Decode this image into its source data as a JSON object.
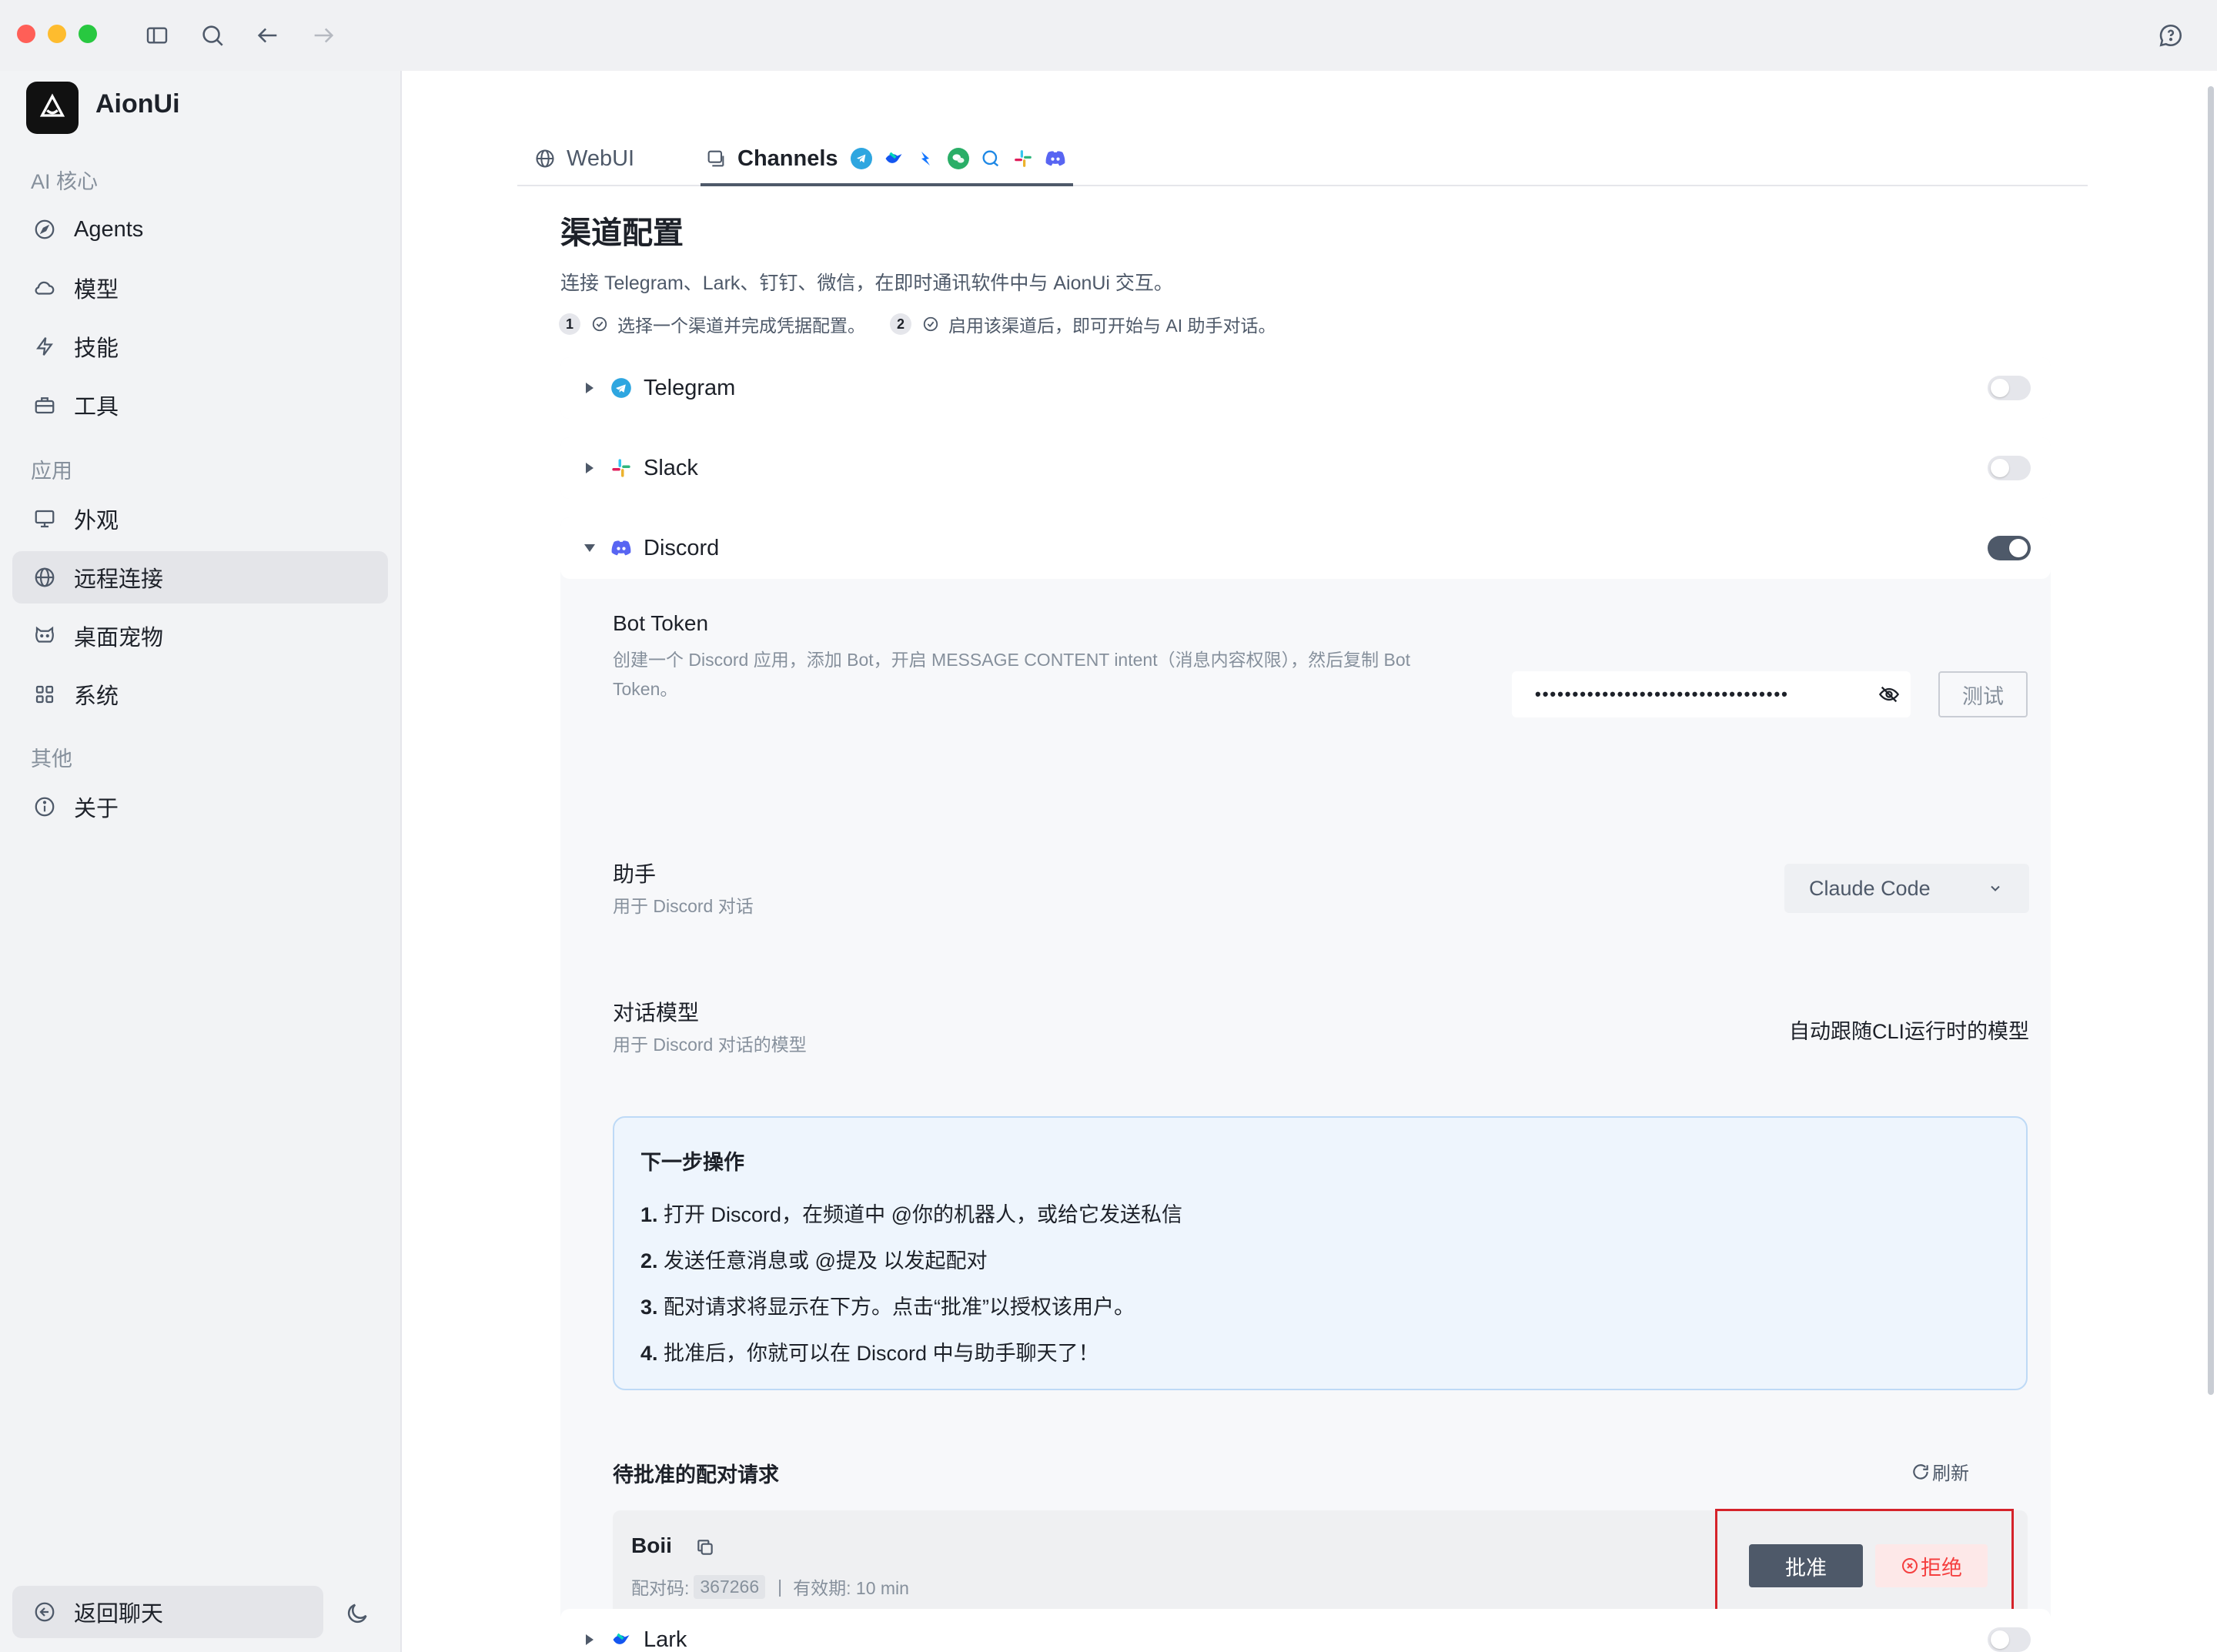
{
  "colors": {
    "accent": "#4e5969",
    "danger": "#f53f3f",
    "highlight": "#d5232a",
    "info_bg": "#eef5fd"
  },
  "titlebar": {
    "icons": [
      "sidebar-toggle-icon",
      "search-icon",
      "arrow-left-icon",
      "arrow-right-icon",
      "feedback-icon"
    ]
  },
  "sidebar": {
    "app_name": "AionUi",
    "sections": [
      {
        "title": "AI 核心",
        "items": [
          {
            "label": "Agents",
            "icon": "compass-icon"
          },
          {
            "label": "模型",
            "icon": "cloud-icon"
          },
          {
            "label": "技能",
            "icon": "lightning-icon"
          },
          {
            "label": "工具",
            "icon": "toolbox-icon"
          }
        ]
      },
      {
        "title": "应用",
        "items": [
          {
            "label": "外观",
            "icon": "monitor-icon"
          },
          {
            "label": "远程连接",
            "icon": "globe-icon",
            "active": true
          },
          {
            "label": "桌面宠物",
            "icon": "cat-icon"
          },
          {
            "label": "系统",
            "icon": "grid-icon"
          }
        ]
      },
      {
        "title": "其他",
        "items": [
          {
            "label": "关于",
            "icon": "info-icon"
          }
        ]
      }
    ],
    "back_label": "返回聊天"
  },
  "tabs": [
    {
      "label": "WebUI",
      "icon": "globe-icon",
      "active": false
    },
    {
      "label": "Channels",
      "icon": "channels-icon",
      "active": true,
      "channel_icons": [
        "telegram-icon",
        "lark-icon",
        "dingtalk-icon",
        "wechat-icon",
        "qq-icon",
        "slack-icon",
        "discord-icon"
      ]
    }
  ],
  "page": {
    "title": "渠道配置",
    "description": "连接 Telegram、Lark、钉钉、微信，在即时通讯软件中与 AionUi 交互。",
    "steps": [
      {
        "num": "1",
        "text": "选择一个渠道并完成凭据配置。"
      },
      {
        "num": "2",
        "text": "启用该渠道后，即可开始与 AI 助手对话。"
      }
    ]
  },
  "channels": {
    "telegram": {
      "name": "Telegram",
      "enabled": false,
      "expanded": false
    },
    "slack": {
      "name": "Slack",
      "enabled": false,
      "expanded": false
    },
    "discord": {
      "name": "Discord",
      "enabled": true,
      "expanded": true,
      "bot_token": {
        "label": "Bot Token",
        "help": "创建一个 Discord 应用，添加 Bot，开启 MESSAGE CONTENT intent（消息内容权限），然后复制 Bot Token。",
        "value_masked": "••••••••••••••••••••••••••••••••••",
        "test_label": "测试"
      },
      "assistant": {
        "label": "助手",
        "help": "用于 Discord 对话",
        "value": "Claude Code"
      },
      "model": {
        "label": "对话模型",
        "help": "用于 Discord 对话的模型",
        "value": "自动跟随CLI运行时的模型"
      },
      "next_steps": {
        "title": "下一步操作",
        "items": [
          {
            "num": "1.",
            "text": "打开 Discord，在频道中 @你的机器人，或给它发送私信"
          },
          {
            "num": "2.",
            "text": "发送任意消息或 @提及 以发起配对"
          },
          {
            "num": "3.",
            "text": "配对请求将显示在下方。点击“批准”以授权该用户。"
          },
          {
            "num": "4.",
            "text": "批准后，你就可以在 Discord 中与助手聊天了！"
          }
        ]
      },
      "pending": {
        "title": "待批准的配对请求",
        "refresh_label": "刷新",
        "requests": [
          {
            "name": "Boii",
            "code_label": "配对码:",
            "code": "367266",
            "separator": "|",
            "expiry": "有效期: 10 min",
            "approve_label": "批准",
            "reject_label": "拒绝"
          }
        ]
      }
    },
    "lark": {
      "name": "Lark",
      "enabled": false,
      "expanded": false
    }
  }
}
